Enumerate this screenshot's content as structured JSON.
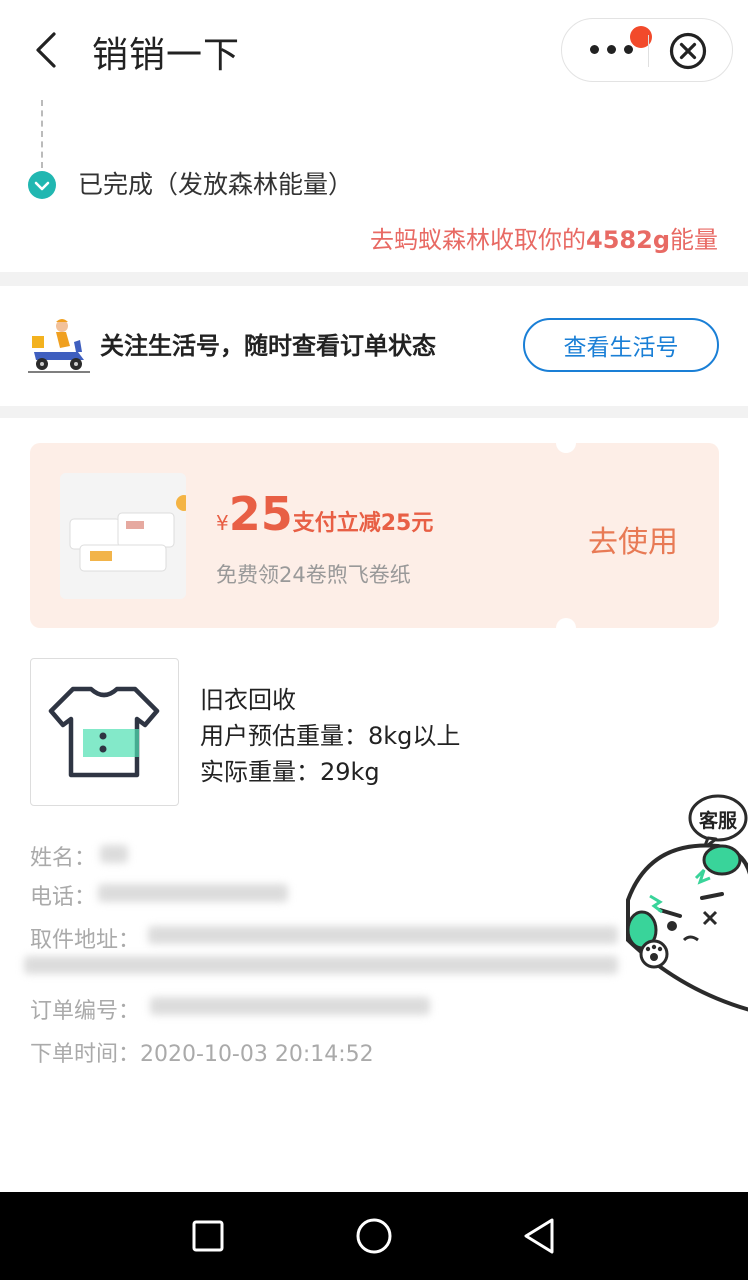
{
  "header": {
    "title": "销销一下",
    "back_icon": "chevron-left-icon",
    "more_icon": "more-dots-icon",
    "close_icon": "close-circle-icon",
    "notification_color": "#f24a2b"
  },
  "status": {
    "text": "已完成（发放森林能量）",
    "forest_prefix": "去蚂蚁森林收取你的",
    "forest_amount": "4582g",
    "forest_suffix": "能量",
    "accent_color": "#21b7b1",
    "link_color": "#e86a64"
  },
  "life_account": {
    "text": "关注生活号，随时查看订单状态",
    "button_label": "查看生活号",
    "button_color": "#1a7fd6"
  },
  "coupon": {
    "currency": "¥",
    "amount": "25",
    "description": "支付立减25元",
    "subtitle": "免费领24卷煦飞卷纸",
    "use_label": "去使用",
    "background": "#fdeee7"
  },
  "item": {
    "title": "旧衣回收",
    "estimated_weight": "用户预估重量：8kg以上",
    "actual_weight": "实际重量：29kg"
  },
  "details": {
    "name_label": "姓名：",
    "phone_label": "电话：",
    "address_label": "取件地址：",
    "order_label": "订单编号：",
    "time_label": "下单时间：",
    "time_value": "2020-10-03 20:14:52"
  },
  "customer_service": {
    "label": "客服"
  },
  "navbar": {
    "icons": [
      "recent-apps-icon",
      "home-icon",
      "back-triangle-icon"
    ]
  }
}
